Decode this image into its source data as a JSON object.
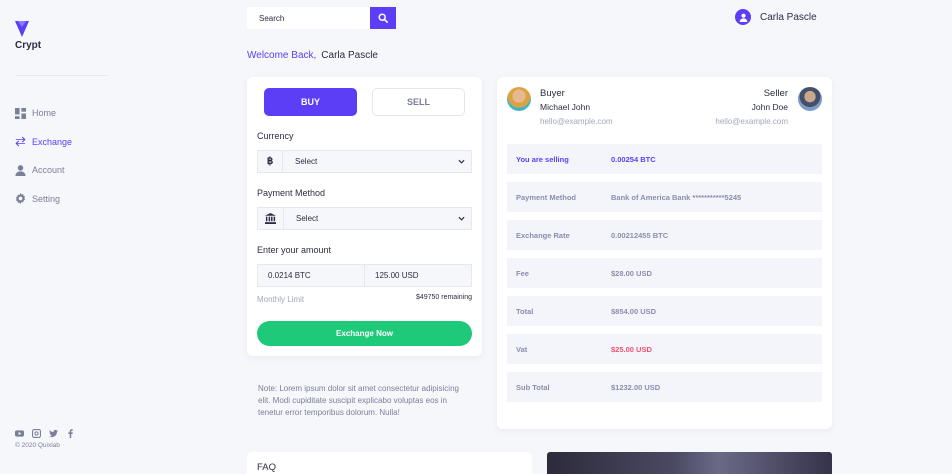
{
  "app": {
    "brand": "Crypt"
  },
  "sidebar": {
    "items": [
      {
        "label": "Home",
        "icon": "dashboard-icon",
        "active": false
      },
      {
        "label": "Exchange",
        "icon": "exchange-arrows-icon",
        "active": true
      },
      {
        "label": "Account",
        "icon": "user-icon",
        "active": false
      },
      {
        "label": "Setting",
        "icon": "gear-icon",
        "active": false
      }
    ],
    "social": [
      "youtube-icon",
      "instagram-icon",
      "twitter-icon",
      "facebook-icon"
    ],
    "copyright": "© 2020 Quixlab"
  },
  "header": {
    "search_placeholder": "Search",
    "user_name": "Carla Pascle"
  },
  "welcome": {
    "greeting": "Welcome Back,",
    "name": "Carla Pascle"
  },
  "exchange": {
    "buy_label": "BUY",
    "sell_label": "SELL",
    "currency_label": "Currency",
    "currency_icon": "bitcoin-icon",
    "currency_value": "Select",
    "payment_label": "Payment Method",
    "payment_icon": "bank-icon",
    "payment_value": "Select",
    "amount_label": "Enter your amount",
    "amount_btc": "0.0214 BTC",
    "amount_usd": "125.00 USD",
    "limit_label": "Monthly Limit",
    "limit_value": "$49750 remaining",
    "exchange_button": "Exchange Now"
  },
  "note": "Note: Lorem ipsum dolor sit amet consectetur adipisicing elit. Modi cupiditate suscipit explicabo voluptas eos in tenetur error temporibus dolorum. Nulla!",
  "details": {
    "buyer": {
      "title": "Buyer",
      "name": "Michael John",
      "email": "hello@example.com"
    },
    "seller": {
      "title": "Seller",
      "name": "John Doe",
      "email": "hello@example.com"
    },
    "rows": [
      {
        "label": "You are selling",
        "value": "0.00254 BTC"
      },
      {
        "label": "Payment Method",
        "value": "Bank of America Bank ***********5245"
      },
      {
        "label": "Exchange Rate",
        "value": "0.00212455 BTC"
      },
      {
        "label": "Fee",
        "value": "$28.00 USD"
      },
      {
        "label": "Total",
        "value": "$854.00 USD"
      },
      {
        "label": "Vat",
        "value": "$25.00 USD"
      },
      {
        "label": "Sub Total",
        "value": "$1232.00 USD"
      }
    ]
  },
  "faq": {
    "title": "FAQ"
  },
  "colors": {
    "accent": "#5b3ef5",
    "success": "#1ec97a",
    "danger": "#f0506e"
  }
}
